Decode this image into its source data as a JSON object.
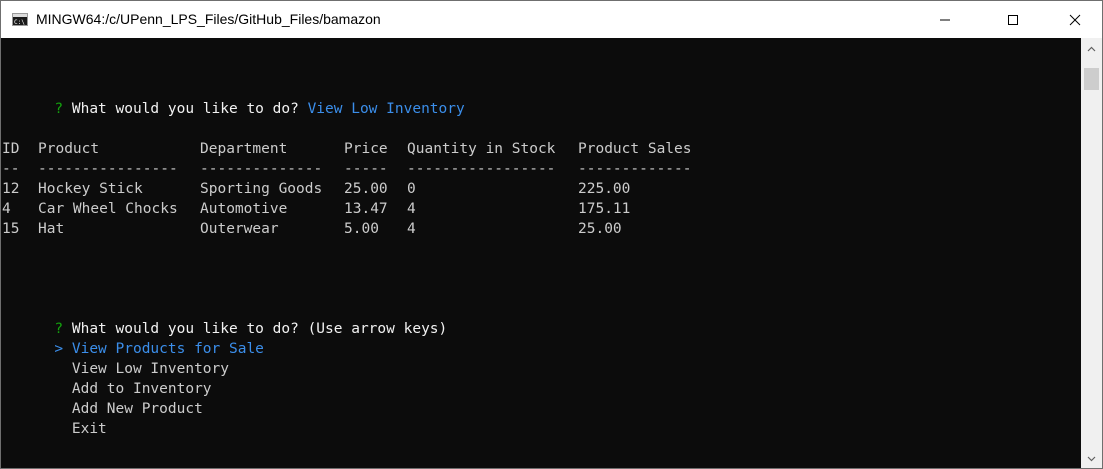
{
  "window": {
    "title": "MINGW64:/c/UPenn_LPS_Files/GitHub_Files/bamazon"
  },
  "terminal": {
    "first_prompt": {
      "marker": "?",
      "question": "What would you like to do?",
      "answer": "View Low Inventory"
    },
    "table": {
      "headers": [
        "ID",
        "Product",
        "Department",
        "Price",
        "Quantity in Stock",
        "Product Sales"
      ],
      "separators": [
        "--",
        "----------------",
        "--------------",
        "-----",
        "-----------------",
        "-------------"
      ],
      "rows": [
        [
          "12",
          "Hockey Stick",
          "Sporting Goods",
          "25.00",
          "0",
          "225.00"
        ],
        [
          "4",
          "Car Wheel Chocks",
          "Automotive",
          "13.47",
          "4",
          "175.11"
        ],
        [
          "15",
          "Hat",
          "Outerwear",
          "5.00",
          "4",
          "25.00"
        ]
      ]
    },
    "second_prompt": {
      "marker": "?",
      "question": "What would you like to do?",
      "hint": "(Use arrow keys)",
      "pointer": ">",
      "choices": [
        {
          "label": "View Products for Sale",
          "selected": true
        },
        {
          "label": "View Low Inventory",
          "selected": false
        },
        {
          "label": "Add to Inventory",
          "selected": false
        },
        {
          "label": "Add New Product",
          "selected": false
        },
        {
          "label": "Exit",
          "selected": false
        }
      ]
    }
  },
  "colors": {
    "background": "#0c0c0c",
    "prompt_marker": "#13a10e",
    "answer": "#3b8eea",
    "text": "#cccccc"
  },
  "icons": {
    "app": "terminal-icon",
    "minimize": "minimize-icon",
    "maximize": "maximize-icon",
    "close": "close-icon"
  }
}
